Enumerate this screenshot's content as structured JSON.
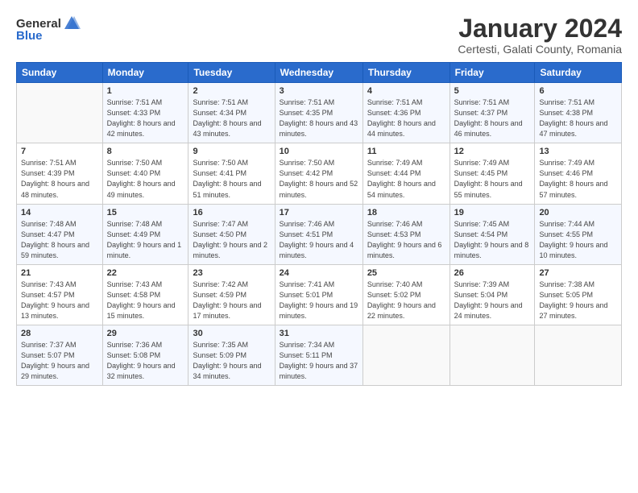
{
  "header": {
    "logo_general": "General",
    "logo_blue": "Blue",
    "title": "January 2024",
    "subtitle": "Certesti, Galati County, Romania"
  },
  "weekdays": [
    "Sunday",
    "Monday",
    "Tuesday",
    "Wednesday",
    "Thursday",
    "Friday",
    "Saturday"
  ],
  "weeks": [
    [
      {
        "day": "",
        "sunrise": "",
        "sunset": "",
        "daylight": ""
      },
      {
        "day": "1",
        "sunrise": "Sunrise: 7:51 AM",
        "sunset": "Sunset: 4:33 PM",
        "daylight": "Daylight: 8 hours and 42 minutes."
      },
      {
        "day": "2",
        "sunrise": "Sunrise: 7:51 AM",
        "sunset": "Sunset: 4:34 PM",
        "daylight": "Daylight: 8 hours and 43 minutes."
      },
      {
        "day": "3",
        "sunrise": "Sunrise: 7:51 AM",
        "sunset": "Sunset: 4:35 PM",
        "daylight": "Daylight: 8 hours and 43 minutes."
      },
      {
        "day": "4",
        "sunrise": "Sunrise: 7:51 AM",
        "sunset": "Sunset: 4:36 PM",
        "daylight": "Daylight: 8 hours and 44 minutes."
      },
      {
        "day": "5",
        "sunrise": "Sunrise: 7:51 AM",
        "sunset": "Sunset: 4:37 PM",
        "daylight": "Daylight: 8 hours and 46 minutes."
      },
      {
        "day": "6",
        "sunrise": "Sunrise: 7:51 AM",
        "sunset": "Sunset: 4:38 PM",
        "daylight": "Daylight: 8 hours and 47 minutes."
      }
    ],
    [
      {
        "day": "7",
        "sunrise": "Sunrise: 7:51 AM",
        "sunset": "Sunset: 4:39 PM",
        "daylight": "Daylight: 8 hours and 48 minutes."
      },
      {
        "day": "8",
        "sunrise": "Sunrise: 7:50 AM",
        "sunset": "Sunset: 4:40 PM",
        "daylight": "Daylight: 8 hours and 49 minutes."
      },
      {
        "day": "9",
        "sunrise": "Sunrise: 7:50 AM",
        "sunset": "Sunset: 4:41 PM",
        "daylight": "Daylight: 8 hours and 51 minutes."
      },
      {
        "day": "10",
        "sunrise": "Sunrise: 7:50 AM",
        "sunset": "Sunset: 4:42 PM",
        "daylight": "Daylight: 8 hours and 52 minutes."
      },
      {
        "day": "11",
        "sunrise": "Sunrise: 7:49 AM",
        "sunset": "Sunset: 4:44 PM",
        "daylight": "Daylight: 8 hours and 54 minutes."
      },
      {
        "day": "12",
        "sunrise": "Sunrise: 7:49 AM",
        "sunset": "Sunset: 4:45 PM",
        "daylight": "Daylight: 8 hours and 55 minutes."
      },
      {
        "day": "13",
        "sunrise": "Sunrise: 7:49 AM",
        "sunset": "Sunset: 4:46 PM",
        "daylight": "Daylight: 8 hours and 57 minutes."
      }
    ],
    [
      {
        "day": "14",
        "sunrise": "Sunrise: 7:48 AM",
        "sunset": "Sunset: 4:47 PM",
        "daylight": "Daylight: 8 hours and 59 minutes."
      },
      {
        "day": "15",
        "sunrise": "Sunrise: 7:48 AM",
        "sunset": "Sunset: 4:49 PM",
        "daylight": "Daylight: 9 hours and 1 minute."
      },
      {
        "day": "16",
        "sunrise": "Sunrise: 7:47 AM",
        "sunset": "Sunset: 4:50 PM",
        "daylight": "Daylight: 9 hours and 2 minutes."
      },
      {
        "day": "17",
        "sunrise": "Sunrise: 7:46 AM",
        "sunset": "Sunset: 4:51 PM",
        "daylight": "Daylight: 9 hours and 4 minutes."
      },
      {
        "day": "18",
        "sunrise": "Sunrise: 7:46 AM",
        "sunset": "Sunset: 4:53 PM",
        "daylight": "Daylight: 9 hours and 6 minutes."
      },
      {
        "day": "19",
        "sunrise": "Sunrise: 7:45 AM",
        "sunset": "Sunset: 4:54 PM",
        "daylight": "Daylight: 9 hours and 8 minutes."
      },
      {
        "day": "20",
        "sunrise": "Sunrise: 7:44 AM",
        "sunset": "Sunset: 4:55 PM",
        "daylight": "Daylight: 9 hours and 10 minutes."
      }
    ],
    [
      {
        "day": "21",
        "sunrise": "Sunrise: 7:43 AM",
        "sunset": "Sunset: 4:57 PM",
        "daylight": "Daylight: 9 hours and 13 minutes."
      },
      {
        "day": "22",
        "sunrise": "Sunrise: 7:43 AM",
        "sunset": "Sunset: 4:58 PM",
        "daylight": "Daylight: 9 hours and 15 minutes."
      },
      {
        "day": "23",
        "sunrise": "Sunrise: 7:42 AM",
        "sunset": "Sunset: 4:59 PM",
        "daylight": "Daylight: 9 hours and 17 minutes."
      },
      {
        "day": "24",
        "sunrise": "Sunrise: 7:41 AM",
        "sunset": "Sunset: 5:01 PM",
        "daylight": "Daylight: 9 hours and 19 minutes."
      },
      {
        "day": "25",
        "sunrise": "Sunrise: 7:40 AM",
        "sunset": "Sunset: 5:02 PM",
        "daylight": "Daylight: 9 hours and 22 minutes."
      },
      {
        "day": "26",
        "sunrise": "Sunrise: 7:39 AM",
        "sunset": "Sunset: 5:04 PM",
        "daylight": "Daylight: 9 hours and 24 minutes."
      },
      {
        "day": "27",
        "sunrise": "Sunrise: 7:38 AM",
        "sunset": "Sunset: 5:05 PM",
        "daylight": "Daylight: 9 hours and 27 minutes."
      }
    ],
    [
      {
        "day": "28",
        "sunrise": "Sunrise: 7:37 AM",
        "sunset": "Sunset: 5:07 PM",
        "daylight": "Daylight: 9 hours and 29 minutes."
      },
      {
        "day": "29",
        "sunrise": "Sunrise: 7:36 AM",
        "sunset": "Sunset: 5:08 PM",
        "daylight": "Daylight: 9 hours and 32 minutes."
      },
      {
        "day": "30",
        "sunrise": "Sunrise: 7:35 AM",
        "sunset": "Sunset: 5:09 PM",
        "daylight": "Daylight: 9 hours and 34 minutes."
      },
      {
        "day": "31",
        "sunrise": "Sunrise: 7:34 AM",
        "sunset": "Sunset: 5:11 PM",
        "daylight": "Daylight: 9 hours and 37 minutes."
      },
      {
        "day": "",
        "sunrise": "",
        "sunset": "",
        "daylight": ""
      },
      {
        "day": "",
        "sunrise": "",
        "sunset": "",
        "daylight": ""
      },
      {
        "day": "",
        "sunrise": "",
        "sunset": "",
        "daylight": ""
      }
    ]
  ]
}
